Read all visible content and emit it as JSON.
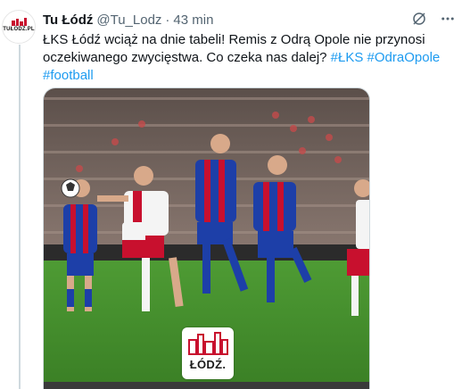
{
  "account": {
    "display_name": "Tu Łódź",
    "handle": "@Tu_Lodz",
    "separator": "·",
    "time": "43 min",
    "avatar_text": "TUŁÓDŹ.PL"
  },
  "tweet": {
    "text_main": "ŁKS Łódź wciąż na dnie tabeli! Remis z Odrą Opole nie przynosi oczekiwanego zwycięstwa. Co czeka nas dalej?",
    "hashtags": [
      "#ŁKS",
      "#OdraOpole",
      "#football"
    ]
  },
  "media": {
    "watermark_text": "ŁÓDŹ."
  },
  "colors": {
    "accent": "#1d9bf0",
    "text_primary": "#0f1419",
    "text_secondary": "#536471",
    "pitch": "#3f8a2c",
    "odra_red": "#c8102e",
    "odra_blue": "#1d3fa8"
  },
  "icons": {
    "grok": "grok-icon",
    "more": "more-icon"
  }
}
